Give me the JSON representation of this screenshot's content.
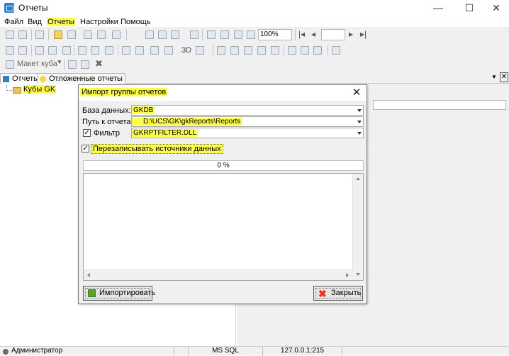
{
  "window": {
    "title": "Отчеты",
    "min_glyph": "—",
    "max_glyph": "☐",
    "close_glyph": "✕"
  },
  "menu": [
    "Файл",
    "Вид",
    "Отчеты",
    "Настройки",
    "Помощь"
  ],
  "toolbar": {
    "zoom": "100%",
    "label_3d": "3D",
    "cube_layout": "Макет куба"
  },
  "tabs": [
    "Отчеты",
    "Отложенные отчеты"
  ],
  "tree": {
    "root": "Кубы GK"
  },
  "dialog": {
    "title": "Импорт группы отчетов",
    "close_glyph": "✕",
    "db_label": "База данных:",
    "db_value": "GKDB",
    "path_label": "Путь к отчетам:",
    "path_value": "D:\\UCS\\GK\\gkReports\\Reports",
    "filter_label": "Фильтр",
    "filter_value": "GKRPTFILTER.DLL",
    "overwrite_label": "Перезаписывать источники данных",
    "progress": "0 %",
    "import_button": "Импортировать",
    "close_button": "Закрыть"
  },
  "status": {
    "user": "Администратор",
    "db": "MS SQL",
    "server": "127.0.0.1:215"
  },
  "colors": {
    "highlight": "#ffff4d",
    "accent": "#2b7fd1"
  }
}
